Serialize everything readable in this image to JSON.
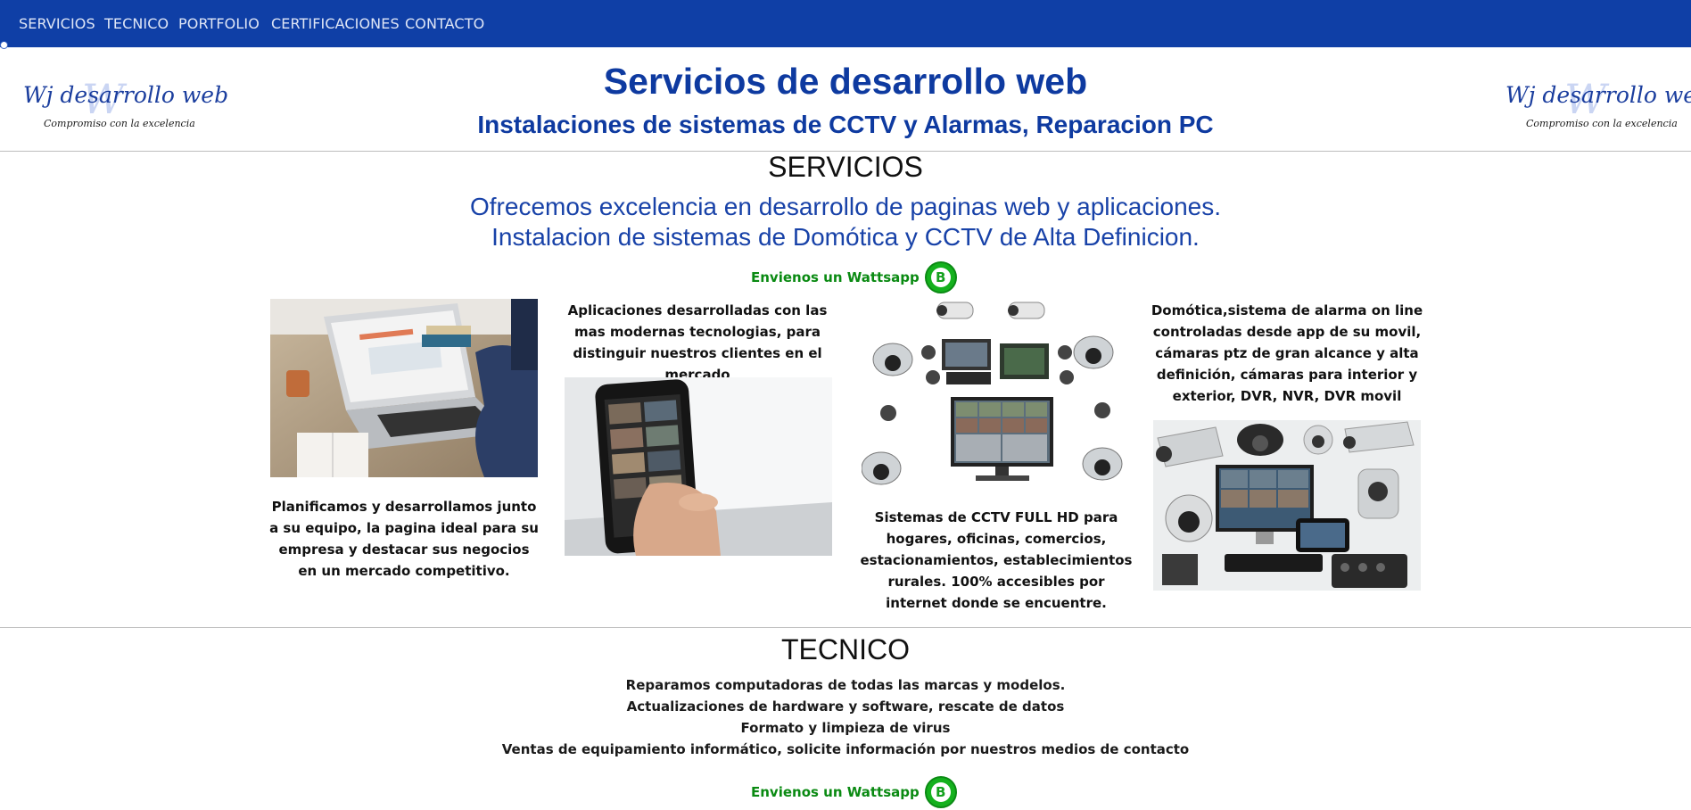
{
  "nav": {
    "items": [
      {
        "label": "SERVICIOS"
      },
      {
        "label": "TECNICO"
      },
      {
        "label": "PORTFOLIO"
      },
      {
        "label": "CERTIFICACIONES"
      },
      {
        "label": "CONTACTO"
      }
    ]
  },
  "header": {
    "logo_name": "Wj desarrollo web",
    "logo_watermark": "W",
    "logo_tagline": "Compromiso con la excelencia",
    "title": "Servicios de desarrollo web",
    "subtitle": "Instalaciones de sistemas de CCTV y Alarmas, Reparacion PC"
  },
  "servicios": {
    "title": "SERVICIOS",
    "intro_line1": "Ofrecemos excelencia en desarrollo de paginas web y aplicaciones.",
    "intro_line2": "Instalacion de sistemas de Domótica y CCTV de Alta Definicion.",
    "whatsapp_label": "Envienos un Wattsapp",
    "cards": [
      {
        "text": "Planificamos y desarrollamos junto a su equipo, la pagina ideal para su empresa y destacar sus negocios en un mercado competitivo."
      },
      {
        "text": "Aplicaciones desarrolladas con las mas modernas tecnologias, para distinguir nuestros clientes en el mercado"
      },
      {
        "text": "Sistemas de CCTV FULL HD para hogares, oficinas, comercios, estacionamientos, establecimientos rurales. 100% accesibles por internet donde se encuentre."
      },
      {
        "text": "Domótica,sistema de alarma on line controladas desde app de su movil, cámaras ptz de gran alcance y alta definición, cámaras para interior y exterior, DVR, NVR, DVR movil"
      }
    ]
  },
  "tecnico": {
    "title": "TECNICO",
    "lines": [
      "Reparamos computadoras de todas las marcas y modelos.",
      "Actualizaciones de hardware y software, rescate de datos",
      "Formato y limpieza de virus",
      "Ventas de equipamiento informático, solicite información por nuestros medios de contacto"
    ],
    "whatsapp_label": "Envienos un Wattsapp"
  },
  "icons": {
    "whatsapp": "whatsapp-icon"
  },
  "colors": {
    "nav_bg": "#0f3fa6",
    "heading_blue": "#0e3aa0",
    "whatsapp_green": "#14b11d"
  }
}
